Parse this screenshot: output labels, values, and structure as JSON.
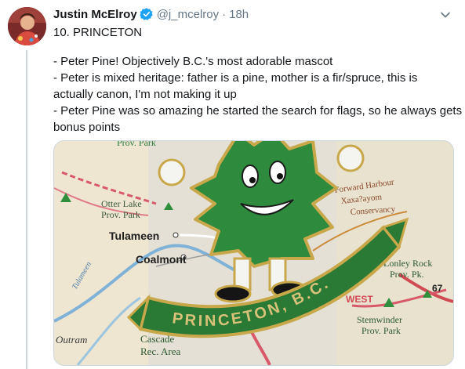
{
  "tweet": {
    "author_name": "Justin McElroy",
    "handle": "@j_mcelroy",
    "separator": "·",
    "time": "18h",
    "lines": [
      "10. PRINCETON",
      "- Peter Pine! Objectively B.C.'s most adorable mascot",
      "- Peter is mixed heritage: father is a pine, mother is a fir/spruce, this is",
      "actually canon, I'm not making it up",
      "- Peter Pine was so amazing he started the search for flags, so he always gets",
      "bonus points"
    ]
  },
  "photo": {
    "map_labels": {
      "prov_park_top": "Prov. Park",
      "otter_lake_1": "Otter Lake",
      "otter_lake_2": "Prov. Park",
      "tulameen": "Tulameen",
      "coalmont": "Coalmont",
      "forward_1": "Forward Harbour",
      "forward_2": "Xaxa?ayom",
      "forward_3": "Conservancy",
      "lonley_1": "Lonley Rock",
      "lonley_2": "Prov. Pk.",
      "stemwinder_1": "Stemwinder",
      "stemwinder_2": "Prov. Park",
      "cascade_1": "Cascade",
      "cascade_2": "Rec. Area",
      "outram": "Outram",
      "route_67": "67",
      "west": "WEST",
      "tulameen_river": "Tulameen"
    },
    "pin_banner": "PRINCETON, B.C."
  },
  "colors": {
    "verified_blue": "#1da1f2",
    "pin_green": "#2e8b3e",
    "pin_gold": "#c8a84a"
  },
  "icons": {
    "verified": "verified-badge-icon",
    "chevron": "chevron-down-icon"
  }
}
